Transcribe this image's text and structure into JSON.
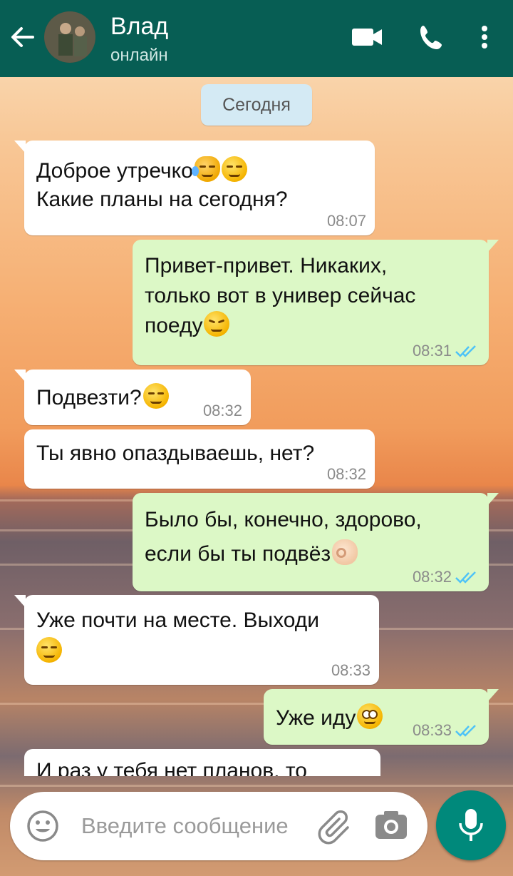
{
  "header": {
    "contact_name": "Влад",
    "status": "онлайн",
    "color": "#075e54"
  },
  "date_chip": "Сегодня",
  "messages": [
    {
      "direction": "in",
      "text": "Доброе утречко",
      "line2": "Какие планы на сегодня?",
      "emoji": [
        "joy-cat",
        "smirk"
      ],
      "time": "08:07"
    },
    {
      "direction": "out",
      "text": "Привет-привет. Никаких,\nтолько вот в универ сейчас\nпоеду",
      "emoji": [
        "weary"
      ],
      "time": "08:31",
      "status": "read"
    },
    {
      "direction": "in",
      "text": "Подвезти?",
      "emoji": [
        "smirk"
      ],
      "time": "08:32"
    },
    {
      "direction": "in",
      "text": "Ты явно опаздываешь, нет?",
      "time": "08:32"
    },
    {
      "direction": "out",
      "text": "Было бы, конечно, здорово,\nесли бы ты подвёз",
      "emoji": [
        "ok-hand"
      ],
      "time": "08:32",
      "status": "read"
    },
    {
      "direction": "in",
      "text": "Уже почти на месте. Выходи",
      "emoji": [
        "smirk"
      ],
      "time": "08:33"
    },
    {
      "direction": "out",
      "text": "Уже иду",
      "emoji": [
        "flushed"
      ],
      "time": "08:33",
      "status": "read"
    },
    {
      "direction": "in",
      "text": "И раз у тебя нет планов, то",
      "partial": true
    }
  ],
  "composer": {
    "placeholder": "Введите сообщение",
    "value": ""
  },
  "colors": {
    "outgoing_bubble": "#dcf8c6",
    "incoming_bubble": "#ffffff",
    "read_ticks": "#4fc3f7",
    "mic_button": "#00897b"
  },
  "icons": [
    "back-arrow-icon",
    "video-call-icon",
    "phone-icon",
    "more-vert-icon",
    "emoji-icon",
    "attach-icon",
    "camera-icon",
    "mic-icon"
  ]
}
